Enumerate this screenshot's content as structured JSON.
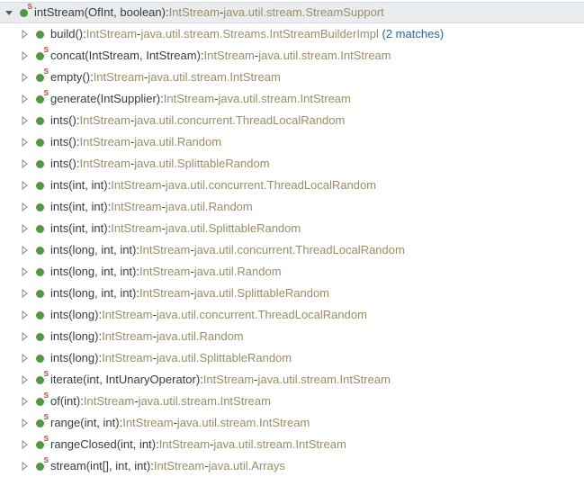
{
  "header": {
    "signature": "intStream(OfInt, boolean)",
    "returnType": "IntStream",
    "pkg": "java.util.stream.StreamSupport"
  },
  "items": [
    {
      "sig": "build()",
      "ret": "IntStream",
      "pkg": "java.util.stream.Streams.IntStreamBuilderImpl",
      "static": false,
      "matches": "(2 matches)"
    },
    {
      "sig": "concat(IntStream, IntStream)",
      "ret": "IntStream",
      "pkg": "java.util.stream.IntStream",
      "static": true
    },
    {
      "sig": "empty()",
      "ret": "IntStream",
      "pkg": "java.util.stream.IntStream",
      "static": true
    },
    {
      "sig": "generate(IntSupplier)",
      "ret": "IntStream",
      "pkg": "java.util.stream.IntStream",
      "static": true
    },
    {
      "sig": "ints()",
      "ret": "IntStream",
      "pkg": "java.util.concurrent.ThreadLocalRandom",
      "static": false
    },
    {
      "sig": "ints()",
      "ret": "IntStream",
      "pkg": "java.util.Random",
      "static": false
    },
    {
      "sig": "ints()",
      "ret": "IntStream",
      "pkg": "java.util.SplittableRandom",
      "static": false
    },
    {
      "sig": "ints(int, int)",
      "ret": "IntStream",
      "pkg": "java.util.concurrent.ThreadLocalRandom",
      "static": false
    },
    {
      "sig": "ints(int, int)",
      "ret": "IntStream",
      "pkg": "java.util.Random",
      "static": false
    },
    {
      "sig": "ints(int, int)",
      "ret": "IntStream",
      "pkg": "java.util.SplittableRandom",
      "static": false
    },
    {
      "sig": "ints(long, int, int)",
      "ret": "IntStream",
      "pkg": "java.util.concurrent.ThreadLocalRandom",
      "static": false
    },
    {
      "sig": "ints(long, int, int)",
      "ret": "IntStream",
      "pkg": "java.util.Random",
      "static": false
    },
    {
      "sig": "ints(long, int, int)",
      "ret": "IntStream",
      "pkg": "java.util.SplittableRandom",
      "static": false
    },
    {
      "sig": "ints(long)",
      "ret": "IntStream",
      "pkg": "java.util.concurrent.ThreadLocalRandom",
      "static": false
    },
    {
      "sig": "ints(long)",
      "ret": "IntStream",
      "pkg": "java.util.Random",
      "static": false
    },
    {
      "sig": "ints(long)",
      "ret": "IntStream",
      "pkg": "java.util.SplittableRandom",
      "static": false
    },
    {
      "sig": "iterate(int, IntUnaryOperator)",
      "ret": "IntStream",
      "pkg": "java.util.stream.IntStream",
      "static": true
    },
    {
      "sig": "of(int)",
      "ret": "IntStream",
      "pkg": "java.util.stream.IntStream",
      "static": true
    },
    {
      "sig": "range(int, int)",
      "ret": "IntStream",
      "pkg": "java.util.stream.IntStream",
      "static": true
    },
    {
      "sig": "rangeClosed(int, int)",
      "ret": "IntStream",
      "pkg": "java.util.stream.IntStream",
      "static": true
    },
    {
      "sig": "stream(int[], int, int)",
      "ret": "IntStream",
      "pkg": "java.util.Arrays",
      "static": true
    }
  ],
  "sep": {
    "colon": " : ",
    "dash": " - "
  }
}
